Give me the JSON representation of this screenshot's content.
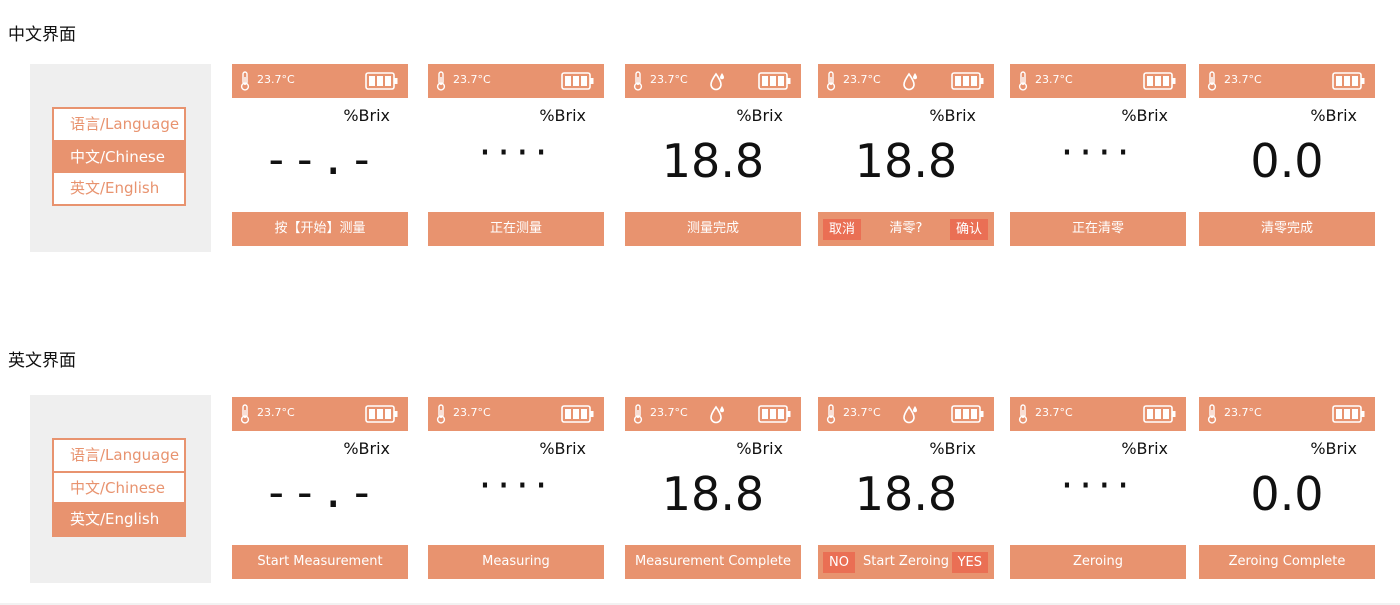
{
  "sections": {
    "cn": {
      "title": "中文界面",
      "lang_menu": {
        "title": "语言/Language",
        "chinese": "中文/Chinese",
        "english": "英文/English",
        "active": "chinese"
      },
      "screens": [
        {
          "temp": "23.7°C",
          "unit": "%Brix",
          "value": "--.-",
          "status": "按【开始】测量",
          "drop": false
        },
        {
          "temp": "23.7°C",
          "unit": "%Brix",
          "value": "····",
          "status": "正在测量",
          "drop": false
        },
        {
          "temp": "23.7°C",
          "unit": "%Brix",
          "value": "18.8",
          "status": "测量完成",
          "drop": true
        },
        {
          "temp": "23.7°C",
          "unit": "%Brix",
          "value": "18.8",
          "drop": true,
          "left_btn": "取消",
          "prompt": "清零?",
          "right_btn": "确认"
        },
        {
          "temp": "23.7°C",
          "unit": "%Brix",
          "value": "····",
          "status": "正在清零",
          "drop": false
        },
        {
          "temp": "23.7°C",
          "unit": "%Brix",
          "value": "0.0",
          "status": "清零完成",
          "drop": false
        }
      ]
    },
    "en": {
      "title": "英文界面",
      "lang_menu": {
        "title": "语言/Language",
        "chinese": "中文/Chinese",
        "english": "英文/English",
        "active": "english"
      },
      "screens": [
        {
          "temp": "23.7°C",
          "unit": "%Brix",
          "value": "--.-",
          "status": "Start Measurement",
          "drop": false
        },
        {
          "temp": "23.7°C",
          "unit": "%Brix",
          "value": "····",
          "status": "Measuring",
          "drop": false
        },
        {
          "temp": "23.7°C",
          "unit": "%Brix",
          "value": "18.8",
          "status": "Measurement Complete",
          "drop": true
        },
        {
          "temp": "23.7°C",
          "unit": "%Brix",
          "value": "18.8",
          "drop": true,
          "left_btn": "NO",
          "prompt": "Start Zeroing",
          "right_btn": "YES"
        },
        {
          "temp": "23.7°C",
          "unit": "%Brix",
          "value": "····",
          "status": "Zeroing",
          "drop": false
        },
        {
          "temp": "23.7°C",
          "unit": "%Brix",
          "value": "0.0",
          "status": "Zeroing Complete",
          "drop": false
        }
      ]
    }
  },
  "icons": {
    "temperature": "thermometer-icon",
    "battery": "battery-full-icon",
    "water_drop": "water-drop-icon"
  },
  "colors": {
    "accent": "#e8936f",
    "button": "#ea6f54",
    "panel_bg": "#efefef"
  }
}
